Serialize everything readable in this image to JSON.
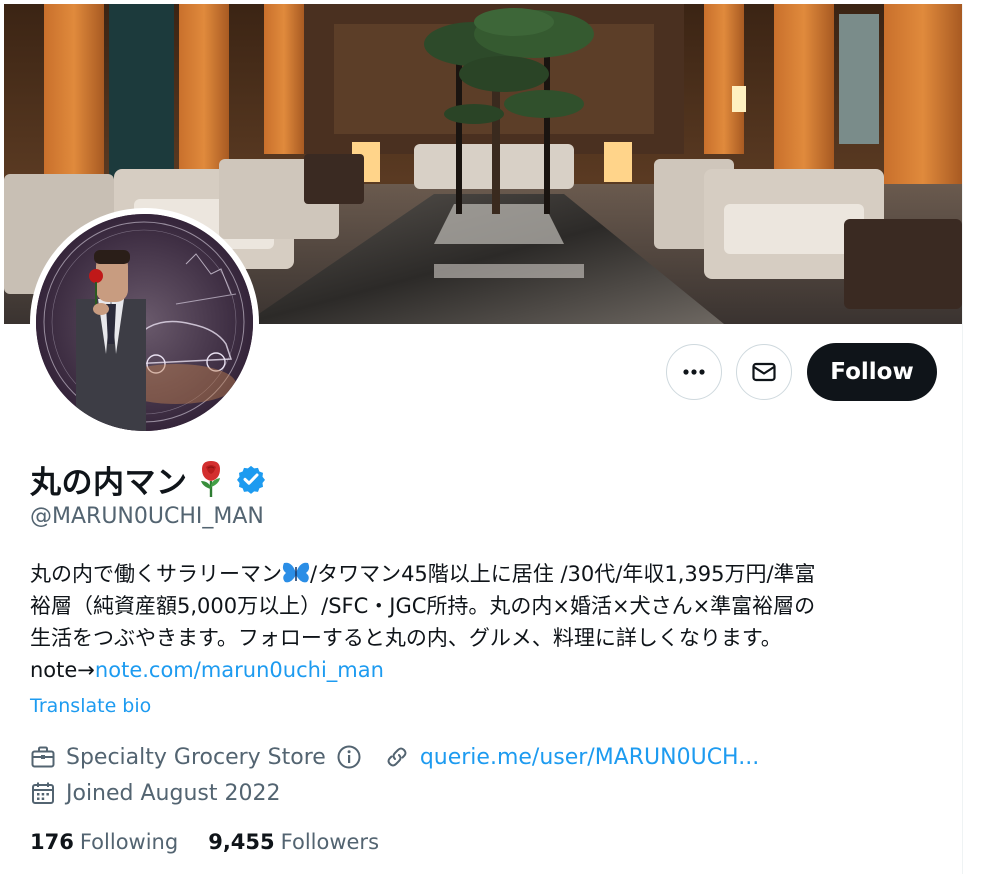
{
  "profile": {
    "display_name": "丸の内マン",
    "name_emoji_icon": "rose-emoji-icon",
    "verified_icon": "verified-badge-icon",
    "handle": "@MARUN0UCHI_MAN",
    "bio_lines": [
      {
        "before_emoji": "丸の内で働くサラリーマン",
        "emoji": "butterfly-emoji-icon",
        "after_emoji": "/タワマン45階以上に居住 /30代/年収1,395万円/準富"
      },
      {
        "text": "裕層（純資産額5,000万以上）/SFC・JGC所持。丸の内×婚活×犬さん×準富裕層の"
      },
      {
        "text": "生活をつぶやきます。フォローすると丸の内、グルメ、料理に詳しくなります。"
      },
      {
        "prefix": "note→",
        "link": "note.com/marun0uchi_man"
      }
    ],
    "translate_label": "Translate bio",
    "category": "Specialty Grocery Store",
    "category_icon": "briefcase-icon",
    "website": "querie.me/user/MARUN0UCH...",
    "joined": "Joined August 2022",
    "joined_icon": "calendar-icon"
  },
  "actions": {
    "more_icon": "more-dots-icon",
    "message_icon": "envelope-icon",
    "follow_label": "Follow"
  },
  "stats": {
    "following_count": "176",
    "following_label": "Following",
    "followers_count": "9,455",
    "followers_label": "Followers"
  },
  "colors": {
    "accent": "#1d9bf0",
    "text_primary": "#0f1419",
    "text_secondary": "#536471",
    "follow_bg": "#0f1419",
    "border": "#cfd9de"
  }
}
